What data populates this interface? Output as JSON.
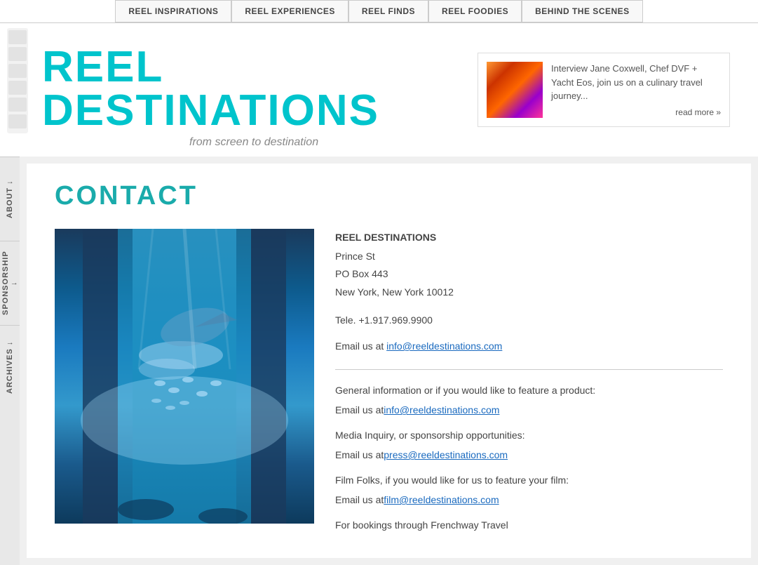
{
  "nav": {
    "items": [
      {
        "label": "REEL INSPIRATIONS",
        "id": "reel-inspirations"
      },
      {
        "label": "REEL EXPERIENCES",
        "id": "reel-experiences"
      },
      {
        "label": "REEL FINDS",
        "id": "reel-finds"
      },
      {
        "label": "REEL FOODIES",
        "id": "reel-foodies"
      },
      {
        "label": "BEHIND THE SCENES",
        "id": "behind-the-scenes"
      }
    ]
  },
  "header": {
    "logo_title": "REEL DESTINATIONS",
    "logo_subtitle": "from screen to destination",
    "featured": {
      "text": "Interview Jane Coxwell, Chef DVF + Yacht Eos, join us on a culinary travel journey...",
      "read_more": "read more »"
    }
  },
  "sidebar": {
    "items": [
      {
        "label": "ABOUT ↓"
      },
      {
        "label": "SPONSORSHIP ↓"
      },
      {
        "label": "ARCHIVES ↓"
      }
    ]
  },
  "contact_page": {
    "title": "CONTACT",
    "company_name": "REEL DESTINATIONS",
    "address_line1": "Prince St",
    "address_line2": "PO Box 443",
    "address_line3": "New York, New York 10012",
    "phone": "Tele. +1.917.969.9900",
    "email_text": "Email us at",
    "email_address": "info@reeldestinations.com",
    "info_section1_line1": "General information or if you would like to feature a product:",
    "info_section1_line2": "Email us at",
    "info_section1_email": "info@reeldestinations.com",
    "info_section2_line1": "Media Inquiry, or sponsorship opportunities:",
    "info_section2_line2": "Email us at",
    "info_section2_email": "press@reeldestinations.com",
    "info_section3_line1": "Film Folks, if you would like for us to feature your film:",
    "info_section3_line2": "Email us at",
    "info_section3_email": "film@reeldestinations.com",
    "info_section4_line1": "For bookings through Frenchway Travel"
  }
}
